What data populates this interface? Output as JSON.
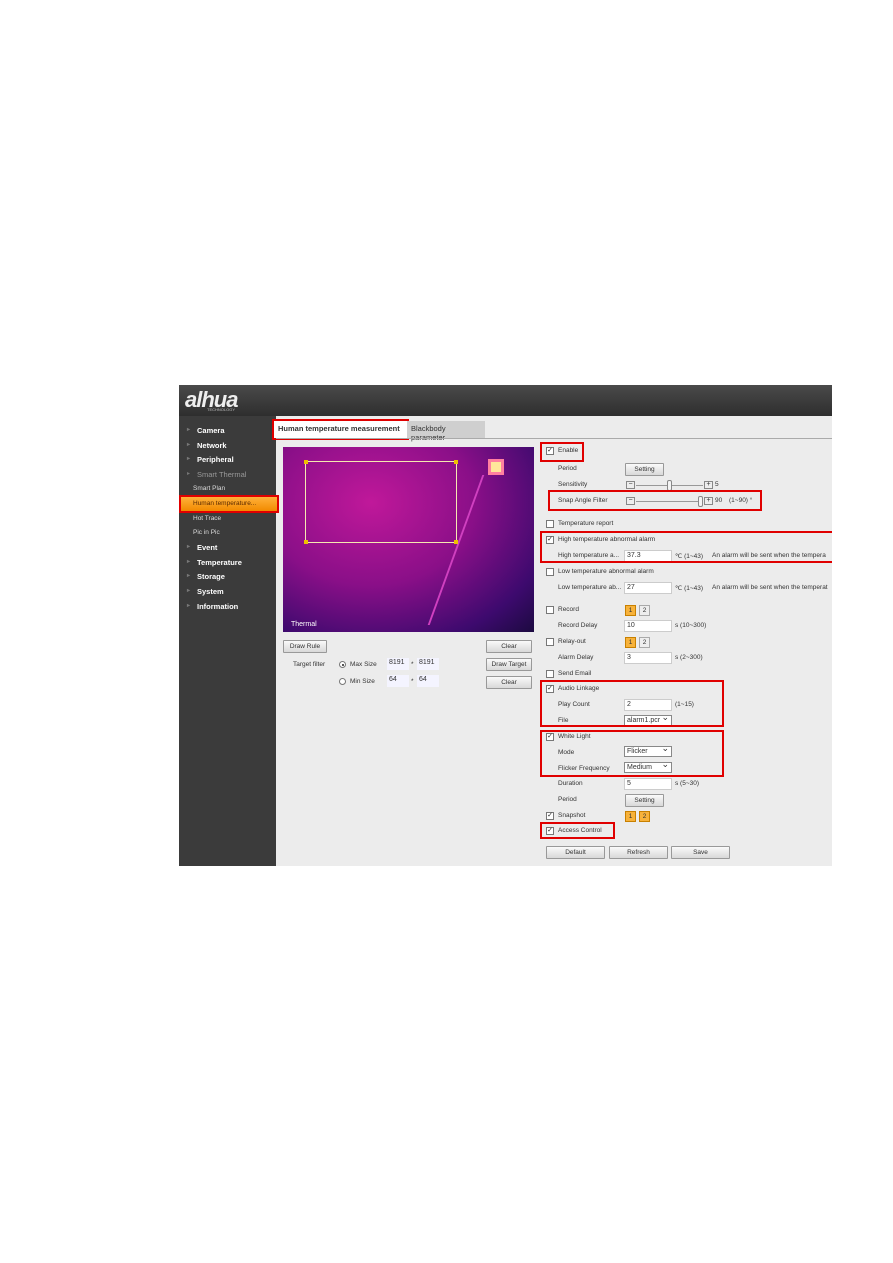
{
  "brand": {
    "logo": "alhua",
    "logo_sub": "TECHNOLOGY"
  },
  "sidebar": {
    "items": [
      {
        "label": "Camera"
      },
      {
        "label": "Network"
      },
      {
        "label": "Peripheral"
      },
      {
        "label": "Smart Thermal"
      },
      {
        "label": "Smart Plan"
      },
      {
        "label": "Human temperature..."
      },
      {
        "label": "Hot Trace"
      },
      {
        "label": "Pic in Pic"
      },
      {
        "label": "Event"
      },
      {
        "label": "Temperature"
      },
      {
        "label": "Storage"
      },
      {
        "label": "System"
      },
      {
        "label": "Information"
      }
    ]
  },
  "tabs": [
    {
      "label": "Human temperature measurement"
    },
    {
      "label": "Blackbody parameter"
    }
  ],
  "video": {
    "overlay": "Thermal",
    "draw_rule": "Draw Rule",
    "clear": "Clear",
    "draw_target": "Draw Target",
    "target_filter": "Target filter",
    "max_size": "Max Size",
    "min_size": "Min Size",
    "max_w": "8191",
    "max_h": "8191",
    "min_w": "64",
    "min_h": "64",
    "times": "*"
  },
  "settings": {
    "enable": "Enable",
    "period": "Period",
    "setting": "Setting",
    "sensitivity": "Sensitivity",
    "sensitivity_value": "5",
    "sensitivity_level": 0.5,
    "snap_angle": "Snap Angle Filter",
    "snap_value": "90",
    "snap_range": "(1~90) °",
    "snap_level": 1.0,
    "temp_report": "Temperature report",
    "high_alarm": "High temperature abnormal alarm",
    "high_label": "High temperature a...",
    "high_value": "37.3",
    "high_range": "℃ (1~43)",
    "high_note": "An alarm will be sent when the tempera",
    "low_alarm": "Low temperature abnormal alarm",
    "low_label": "Low temperature ab...",
    "low_value": "27",
    "low_range": "℃ (1~43)",
    "low_note": "An alarm will be sent when the temperat",
    "record": "Record",
    "ch1": "1",
    "ch2": "2",
    "record_delay": "Record Delay",
    "record_delay_value": "10",
    "record_delay_range": "s (10~300)",
    "relay": "Relay-out",
    "alarm_delay": "Alarm Delay",
    "alarm_delay_value": "3",
    "alarm_delay_range": "s (2~300)",
    "send_email": "Send Email",
    "audio": "Audio Linkage",
    "play_count": "Play Count",
    "play_count_value": "2",
    "play_count_range": "(1~15)",
    "file": "File",
    "file_value": "alarm1.pcr",
    "white_light": "White Light",
    "mode": "Mode",
    "mode_value": "Flicker",
    "flicker_freq": "Flicker Frequency",
    "flicker_value": "Medium",
    "duration": "Duration",
    "duration_value": "5",
    "duration_range": "s (5~30)",
    "period2": "Period",
    "snapshot": "Snapshot",
    "access": "Access Control",
    "default": "Default",
    "refresh": "Refresh",
    "save": "Save",
    "check": "✓"
  },
  "colors": {
    "highlight": "#e00000",
    "active": "#f7a21b"
  }
}
